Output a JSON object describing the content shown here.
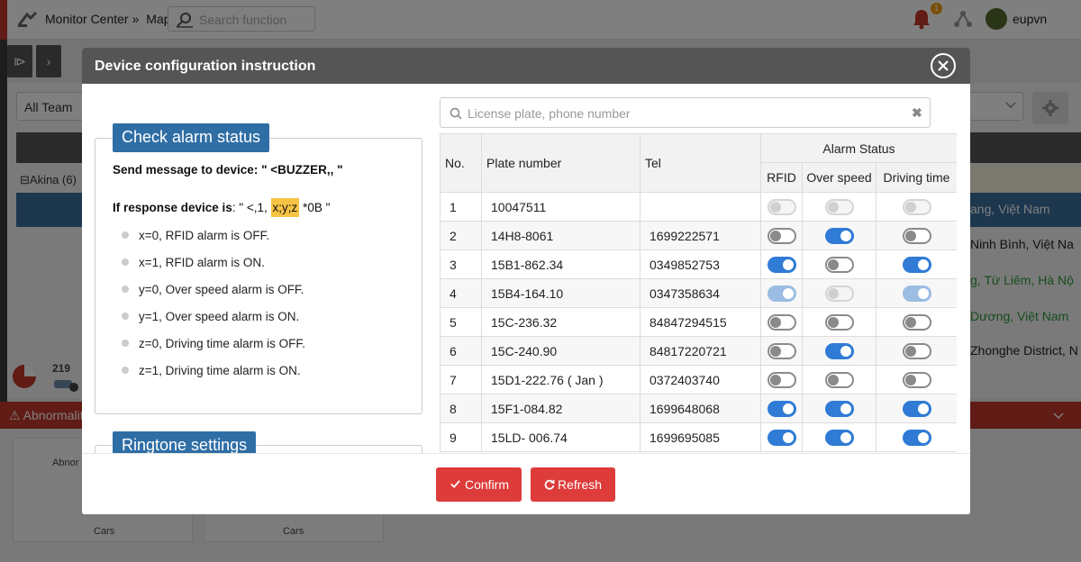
{
  "topbar": {
    "breadcrumb_app": "Monitor Center",
    "breadcrumb_sep": "»",
    "breadcrumb_page": "Map",
    "search_placeholder": "Search function",
    "notification_count": "1",
    "username": "eupvn"
  },
  "background": {
    "team_select": "All Team",
    "group_label": "⊟Akina (6)",
    "vehicle_count": "219",
    "abnormality_label": "⚠ Abnormalit",
    "cards": [
      {
        "top": "Abnor",
        "bottom": "Cars"
      },
      {
        "top": "",
        "bottom": "Cars"
      }
    ],
    "locations": [
      {
        "text": "ang, Việt Nam",
        "color": "#ffffff"
      },
      {
        "text": "Ninh Bình, Việt Na",
        "color": "#222222"
      },
      {
        "text": "g, Từ Liêm, Hà Nộ",
        "color": "#2e9a3a"
      },
      {
        "text": "Dương, Việt Nam",
        "color": "#2e9a3a"
      },
      {
        "text": "Zhonghe District, N",
        "color": "#222222"
      }
    ]
  },
  "modal": {
    "title": "Device configuration instruction",
    "check_alarm_heading": "Check alarm status",
    "send_message": "Send message to device: \" <BUZZER,, \"",
    "response_label": "If response device is",
    "response_prefix": ": \" <,1,",
    "response_highlight": "x;y;z",
    "response_suffix": "*0B \"",
    "bullets": [
      "x=0, RFID alarm is OFF.",
      "x=1, RFID alarm is ON.",
      "y=0, Over speed alarm is OFF.",
      "y=1, Over speed alarm is ON.",
      "z=0, Driving time alarm is OFF.",
      "z=1, Driving time alarm is ON."
    ],
    "ringtone_heading": "Ringtone settings",
    "search_placeholder": "License plate, phone number",
    "search_value": "",
    "clear_symbol": "✖",
    "table": {
      "headers": {
        "no": "No.",
        "plate": "Plate number",
        "tel": "Tel",
        "alarm_status": "Alarm Status",
        "rfid": "RFID",
        "over_speed": "Over speed",
        "driving_time": "Driving time"
      },
      "rows": [
        {
          "no": "1",
          "plate": "10047511",
          "tel": "",
          "rfid": false,
          "over_speed": false,
          "driving_time": false,
          "disabled": true
        },
        {
          "no": "2",
          "plate": "14H8-8061",
          "tel": "1699222571",
          "rfid": false,
          "over_speed": true,
          "driving_time": false,
          "disabled": false
        },
        {
          "no": "3",
          "plate": "15B1-862.34",
          "tel": "0349852753",
          "rfid": true,
          "over_speed": false,
          "driving_time": true,
          "disabled": false
        },
        {
          "no": "4",
          "plate": "15B4-164.10",
          "tel": "0347358634",
          "rfid": true,
          "over_speed": false,
          "driving_time": true,
          "disabled": true
        },
        {
          "no": "5",
          "plate": "15C-236.32",
          "tel": "84847294515",
          "rfid": false,
          "over_speed": false,
          "driving_time": false,
          "disabled": false
        },
        {
          "no": "6",
          "plate": "15C-240.90",
          "tel": "84817220721",
          "rfid": false,
          "over_speed": true,
          "driving_time": false,
          "disabled": false
        },
        {
          "no": "7",
          "plate": "15D1-222.76 ( Jan )",
          "tel": "0372403740",
          "rfid": false,
          "over_speed": false,
          "driving_time": false,
          "disabled": false
        },
        {
          "no": "8",
          "plate": "15F1-084.82",
          "tel": "1699648068",
          "rfid": true,
          "over_speed": true,
          "driving_time": true,
          "disabled": false
        },
        {
          "no": "9",
          "plate": "15LD- 006.74",
          "tel": "1699695085",
          "rfid": true,
          "over_speed": true,
          "driving_time": true,
          "disabled": false
        }
      ]
    },
    "confirm_label": "Confirm",
    "refresh_label": "Refresh"
  },
  "colors": {
    "header_dark": "#555555",
    "section_blue": "#2f6ea5",
    "toggle_on": "#2f7bd6",
    "button_red": "#de3b3b",
    "highlight": "#f6c343"
  }
}
